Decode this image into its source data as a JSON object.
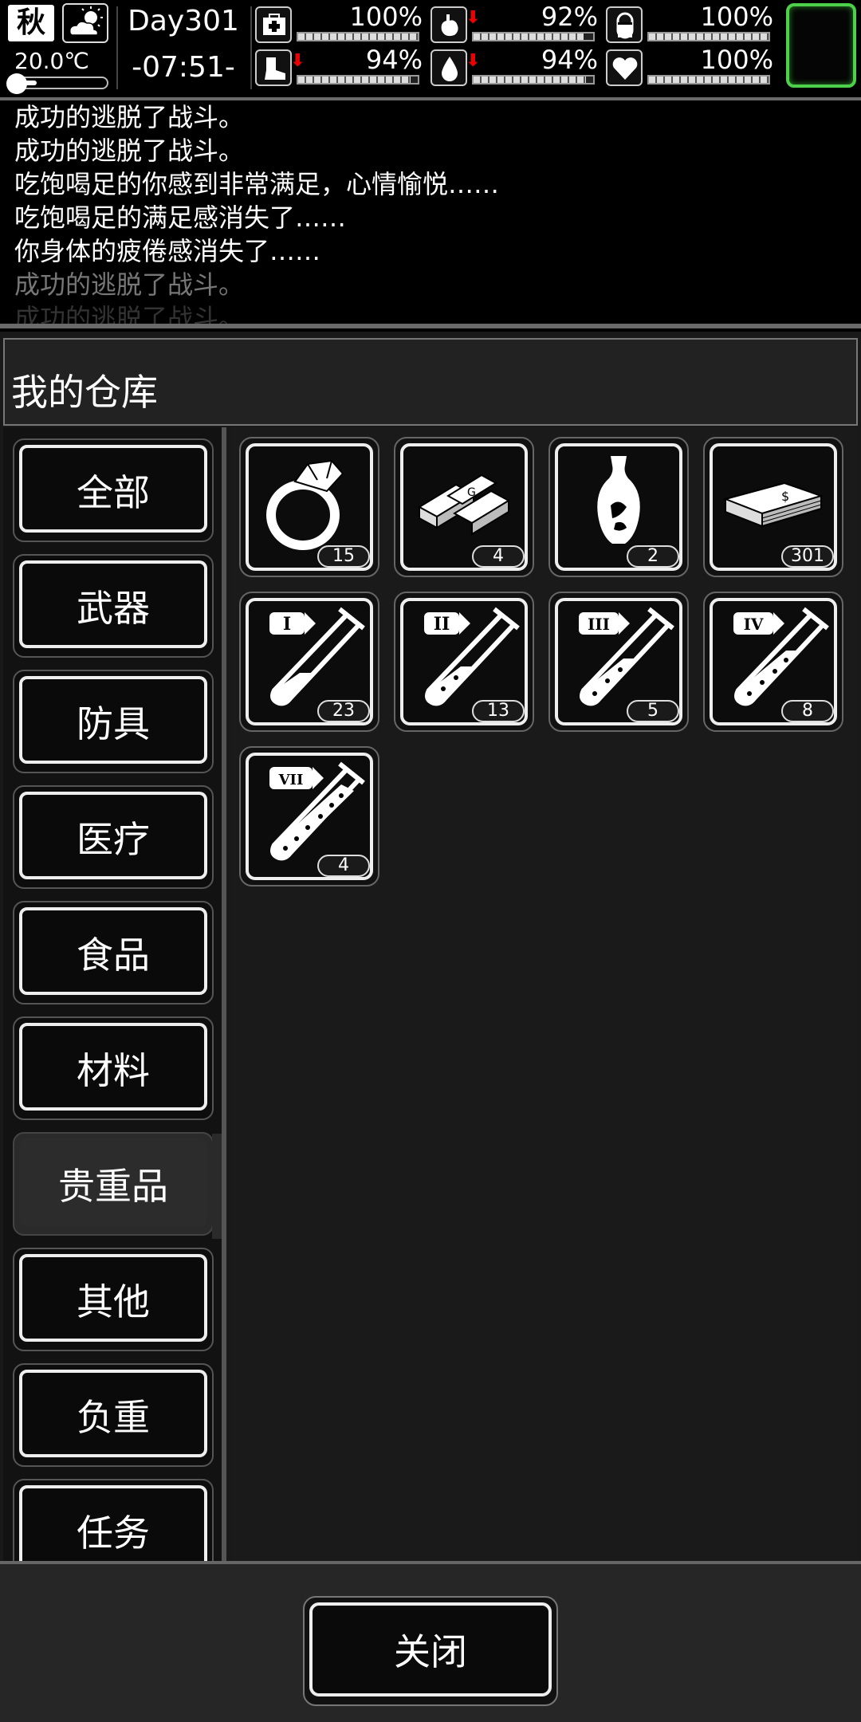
{
  "status": {
    "season": "秋",
    "weather_icon": "partly-cloudy-icon",
    "temperature": "20.0℃",
    "temperature_level": 0.2,
    "day": "Day301",
    "time": "-07:51-",
    "stats": [
      {
        "name": "health",
        "icon": "medkit-icon",
        "pct": "100%",
        "value": 1.0,
        "down": false
      },
      {
        "name": "hunger",
        "icon": "stomach-icon",
        "pct": "92%",
        "value": 0.92,
        "down": true
      },
      {
        "name": "medicine",
        "icon": "pill-icon",
        "pct": "100%",
        "value": 1.0,
        "down": false
      },
      {
        "name": "stamina",
        "icon": "boot-icon",
        "pct": "94%",
        "value": 0.94,
        "down": true
      },
      {
        "name": "thirst",
        "icon": "water-drop-icon",
        "pct": "94%",
        "value": 0.94,
        "down": true
      },
      {
        "name": "mood",
        "icon": "heart-icon",
        "pct": "100%",
        "value": 1.0,
        "down": false
      }
    ]
  },
  "log": [
    "成功的逃脱了战斗。",
    "成功的逃脱了战斗。",
    "吃饱喝足的你感到非常满足，心情愉悦……",
    "吃饱喝足的满足感消失了……",
    "你身体的疲倦感消失了……",
    "成功的逃脱了战斗。",
    "成功的逃脱了战斗。"
  ],
  "panel": {
    "title": "我的仓库",
    "categories": [
      "全部",
      "武器",
      "防具",
      "医疗",
      "食品",
      "材料",
      "贵重品",
      "其他",
      "负重",
      "任务"
    ],
    "active_category": "贵重品",
    "items": [
      {
        "icon": "diamond-ring-icon",
        "count": "15"
      },
      {
        "icon": "gold-bars-icon",
        "count": "4"
      },
      {
        "icon": "porcelain-vase-icon",
        "count": "2"
      },
      {
        "icon": "cash-stack-icon",
        "count": "301"
      },
      {
        "icon": "test-tube-i-icon",
        "numeral": "I",
        "count": "23"
      },
      {
        "icon": "test-tube-ii-icon",
        "numeral": "II",
        "count": "13"
      },
      {
        "icon": "test-tube-iii-icon",
        "numeral": "III",
        "count": "5"
      },
      {
        "icon": "test-tube-iv-icon",
        "numeral": "IV",
        "count": "8"
      },
      {
        "icon": "test-tube-vii-icon",
        "numeral": "VII",
        "count": "4"
      }
    ],
    "close_label": "关闭"
  },
  "colors": {
    "accent_green": "#4ed14a",
    "warning_red": "#e00000"
  }
}
